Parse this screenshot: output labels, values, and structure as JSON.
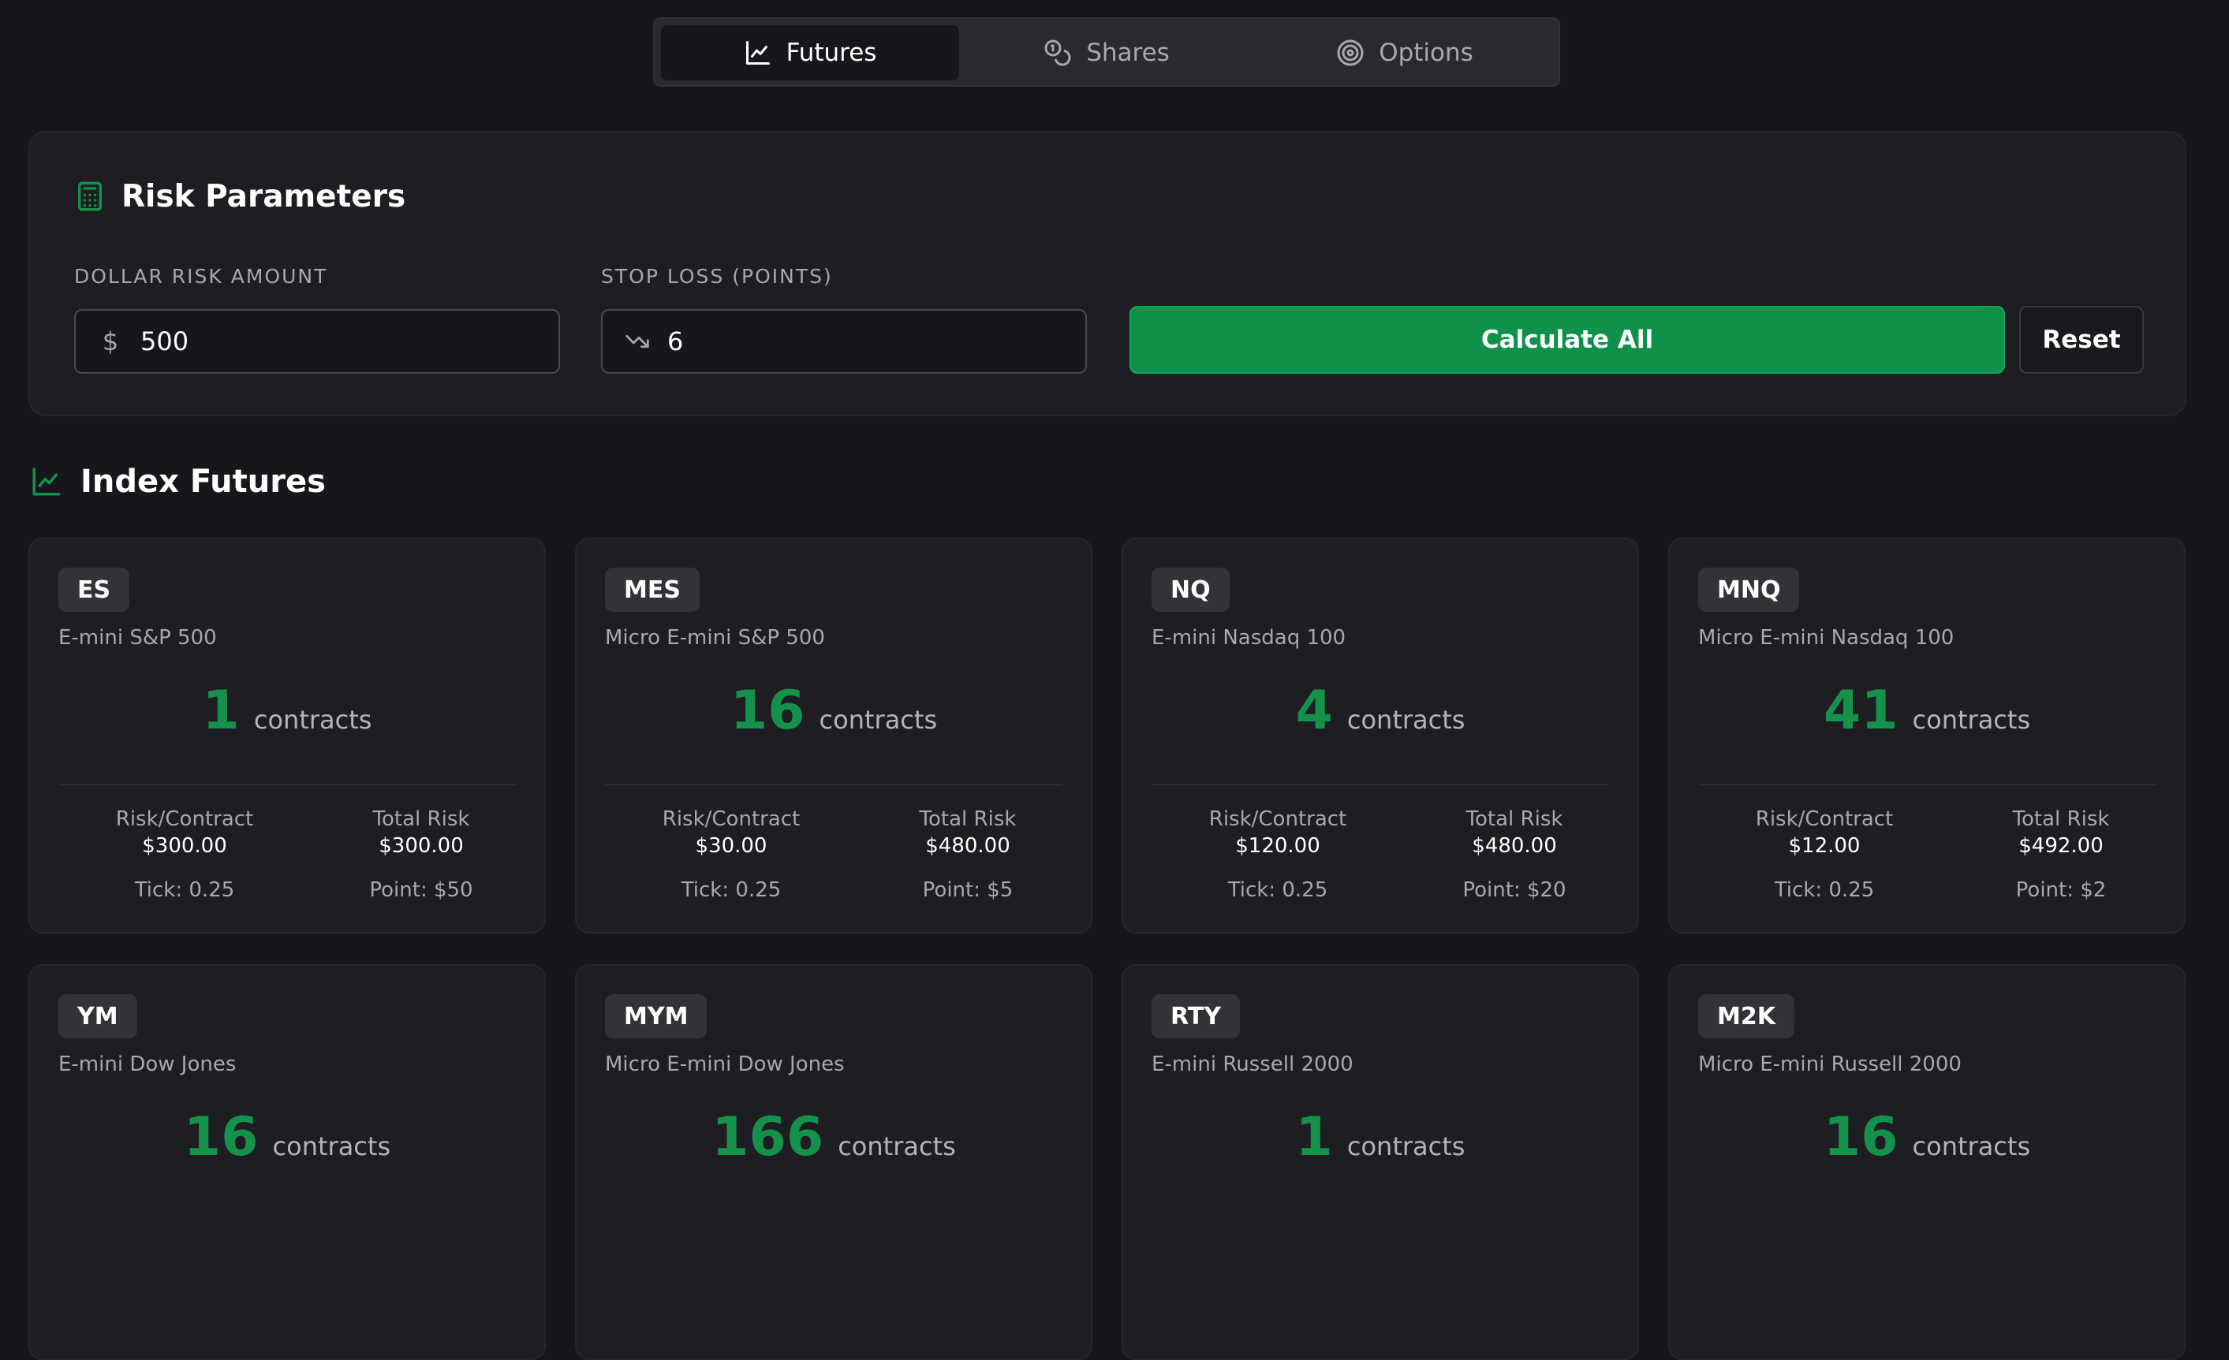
{
  "tabs": [
    {
      "label": "Futures",
      "icon": "line-chart-icon",
      "active": true
    },
    {
      "label": "Shares",
      "icon": "coins-icon",
      "active": false
    },
    {
      "label": "Options",
      "icon": "target-icon",
      "active": false
    }
  ],
  "risk_panel": {
    "title": "Risk Parameters",
    "icon": "calculator-icon",
    "dollar_label": "DOLLAR RISK AMOUNT",
    "dollar_prefix": "$",
    "dollar_value": "500",
    "stop_label": "STOP LOSS (POINTS)",
    "stop_icon": "trending-down-icon",
    "stop_value": "6",
    "calculate_label": "Calculate All",
    "reset_label": "Reset"
  },
  "section": {
    "title": "Index Futures",
    "icon": "line-chart-icon"
  },
  "colors": {
    "accent": "#0f914a",
    "accent_text": "#14924c",
    "background": "#17161a",
    "card": "#1e1d21"
  },
  "cards": [
    {
      "symbol": "ES",
      "name": "E-mini S&P 500",
      "contracts": "1",
      "unit": "contracts",
      "risk_label": "Risk/Contract",
      "risk_value": "$300.00",
      "total_label": "Total Risk",
      "total_value": "$300.00",
      "tick": "Tick: 0.25",
      "point": "Point: $50"
    },
    {
      "symbol": "MES",
      "name": "Micro E-mini S&P 500",
      "contracts": "16",
      "unit": "contracts",
      "risk_label": "Risk/Contract",
      "risk_value": "$30.00",
      "total_label": "Total Risk",
      "total_value": "$480.00",
      "tick": "Tick: 0.25",
      "point": "Point: $5"
    },
    {
      "symbol": "NQ",
      "name": "E-mini Nasdaq 100",
      "contracts": "4",
      "unit": "contracts",
      "risk_label": "Risk/Contract",
      "risk_value": "$120.00",
      "total_label": "Total Risk",
      "total_value": "$480.00",
      "tick": "Tick: 0.25",
      "point": "Point: $20"
    },
    {
      "symbol": "MNQ",
      "name": "Micro E-mini Nasdaq 100",
      "contracts": "41",
      "unit": "contracts",
      "risk_label": "Risk/Contract",
      "risk_value": "$12.00",
      "total_label": "Total Risk",
      "total_value": "$492.00",
      "tick": "Tick: 0.25",
      "point": "Point: $2"
    },
    {
      "symbol": "YM",
      "name": "E-mini Dow Jones",
      "contracts": "16",
      "unit": "contracts"
    },
    {
      "symbol": "MYM",
      "name": "Micro E-mini Dow Jones",
      "contracts": "166",
      "unit": "contracts"
    },
    {
      "symbol": "RTY",
      "name": "E-mini Russell 2000",
      "contracts": "1",
      "unit": "contracts"
    },
    {
      "symbol": "M2K",
      "name": "Micro E-mini Russell 2000",
      "contracts": "16",
      "unit": "contracts"
    }
  ]
}
